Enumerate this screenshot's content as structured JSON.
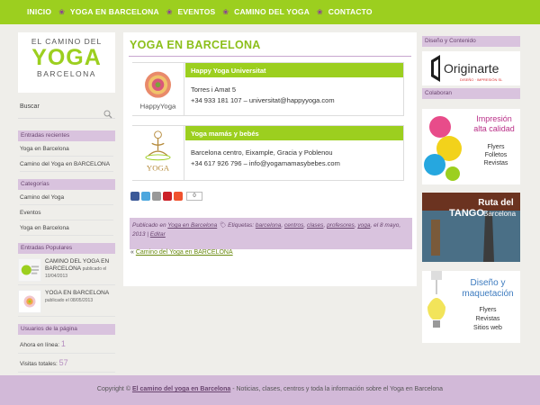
{
  "nav": [
    "INICIO",
    "YOGA EN BARCELONA",
    "EVENTOS",
    "CAMINO DEL YOGA",
    "CONTACTO"
  ],
  "logo": {
    "line1": "EL CAMINO DEL",
    "line2": "YOGA",
    "line3": "BARCELONA"
  },
  "search": {
    "label": "Buscar"
  },
  "widgets": {
    "recent": {
      "title": "Entradas recientes",
      "items": [
        "Yoga en Barcelona",
        "Camino del Yoga en BARCELONA"
      ]
    },
    "categories": {
      "title": "Categorías",
      "items": [
        "Camino del Yoga",
        "Eventos",
        "Yoga en Barcelona"
      ]
    },
    "popular": {
      "title": "Entradas Populares",
      "items": [
        {
          "title": "CAMINO DEL YOGA EN BARCELONA",
          "date": "publicado el 10/04/2013"
        },
        {
          "title": "YOGA EN BARCELONA",
          "date": "publicado el 08/05/2013"
        }
      ]
    },
    "users": {
      "title": "Usuarios de la página",
      "online_label": "Ahora en línea:",
      "online": "1",
      "total_label": "Visitas totales:",
      "total": "57"
    }
  },
  "main": {
    "title": "YOGA EN BARCELONA",
    "cards": [
      {
        "name": "Happy Yoga Universitat",
        "line1": "Torres i Amat 5",
        "line2": "+34 933 181 107 – universitat@happyyoga.com",
        "img_text": "HappyYoga"
      },
      {
        "name": "Yoga mamás y bebés",
        "line1": "Barcelona centro, Eixample, Gracia y Poblenou",
        "line2": "+34 617 926 796 – info@yogamamasybebes.com",
        "img_text": "YOGA"
      }
    ],
    "share_count": "0",
    "meta": {
      "published": "Publicado en",
      "category": "Yoga en Barcelona",
      "tags_label": "Etiquetas:",
      "tags": [
        "barcelona",
        "centros",
        "clases",
        "profesores",
        "yoga"
      ],
      "date": "el 8 mayo, 2013",
      "edit": "Editar"
    },
    "prev": "Camino del Yoga en BARCELONA"
  },
  "right": {
    "design_title": "Diseño y Contenido",
    "brand": "Originarte",
    "brand_sub": "DISEÑO · IMPRESIÓN SL",
    "collab_title": "Colaboran",
    "ad1": {
      "l1": "Impresión",
      "l2": "alta calidad",
      "l3": "Flyers",
      "l4": "Folletos",
      "l5": "Revistas"
    },
    "ad2": {
      "l1": "Ruta del",
      "l2": "TANGO",
      "l3": "Barcelona"
    },
    "ad3": {
      "l1": "Diseño y",
      "l2": "maquetación",
      "l3": "Flyers",
      "l4": "Revistas",
      "l5": "Sitios web"
    }
  },
  "footer": {
    "prefix": "Copyright ©",
    "link": "El camino del yoga en Barcelona",
    "suffix": " - Noticias, clases, centros y toda la información sobre el Yoga en Barcelona"
  },
  "colors": {
    "green": "#9ccf1f",
    "lilac": "#d9c3de",
    "purple": "#6a4670"
  }
}
